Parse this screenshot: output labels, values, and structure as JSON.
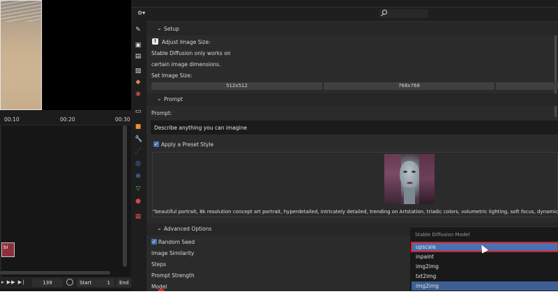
{
  "timeline": {
    "ticks": [
      "00:10",
      "00:20",
      "00:30"
    ],
    "clip_label": "bi",
    "current_frame": "139",
    "start_label": "Start",
    "start_value": "1",
    "end_label": "End"
  },
  "properties": {
    "setup": {
      "header": "Setup",
      "adjust_label": "Adjust Image Size:",
      "note_line1": "Stable Diffusion only works on",
      "note_line2": "certain image dimensions.",
      "set_size_label": "Set Image Size:",
      "sizes": [
        "512x512",
        "768x768"
      ]
    },
    "prompt": {
      "header": "Prompt",
      "label": "Prompt:",
      "placeholder": "Describe anything you can imagine",
      "preset_label": "Apply a Preset Style",
      "preset_checked": true,
      "preset_caption": "\"beautiful portrait, 8k resolution concept art portrait, hyperdetailed, intricately detailed, trending on Artstation, triadic colors, volumetric lighting, soft focus, dynamic lighting\""
    },
    "advanced": {
      "header": "Advanced Options",
      "random_seed": "Random Seed",
      "image_similarity": "Image Similarity",
      "steps": "Steps",
      "prompt_strength": "Prompt Strength",
      "model": "Model"
    }
  },
  "dropdown": {
    "title": "Stable Diffusion Model",
    "items": [
      "upscale",
      "inpaint",
      "img2img",
      "txt2img",
      "img2img"
    ],
    "hovered_index": 0,
    "selected_index": 4
  },
  "colors": {
    "accent": "#4772b3",
    "highlight_outline": "#d92020",
    "clip": "#8c2f3a"
  }
}
